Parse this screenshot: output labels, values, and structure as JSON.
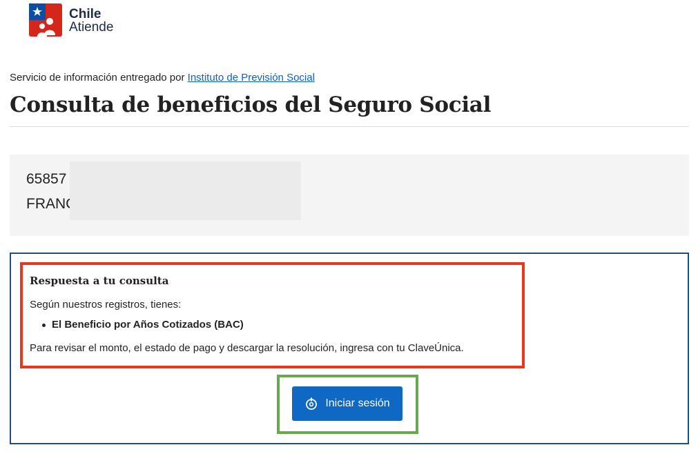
{
  "header": {
    "logo_line1": "Chile",
    "logo_line2": "Atiende"
  },
  "provider": {
    "prefix": "Servicio de información entregado por ",
    "link_label": "Instituto de Previsión Social"
  },
  "page": {
    "title": "Consulta de beneficios del Seguro Social"
  },
  "user": {
    "id_partial": "65857",
    "name_partial": "FRANC"
  },
  "result": {
    "title": "Respuesta a tu consulta",
    "intro": "Según nuestros registros, tienes:",
    "benefits": [
      "El Beneficio por Años Cotizados (BAC)"
    ],
    "footer": "Para revisar el monto, el estado de pago y descargar la resolución, ingresa con tu ClaveÚnica."
  },
  "login": {
    "label": "Iniciar sesión",
    "icon": "clave-unica-icon"
  },
  "colors": {
    "primary": "#0f69c4",
    "panel_border": "#1d4f7c",
    "highlight_red": "#e8361f",
    "highlight_green": "#6aa84f"
  }
}
